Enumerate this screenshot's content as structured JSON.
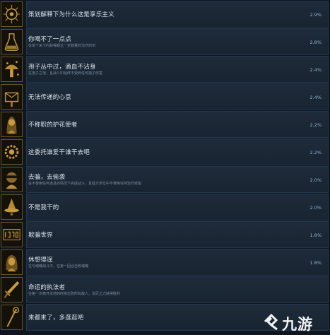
{
  "achievements": [
    {
      "title": "策划解释下为什么这是享乐主义",
      "description": "",
      "percent": "2.9%",
      "icon": "ornate-sun-icon"
    },
    {
      "title": "你喝不了一点点",
      "description": "在单个关卡内获得超过一定数量的治疗药剂",
      "percent": "2.8%",
      "icon": "flask-icon"
    },
    {
      "title": "孢子丛中过，滴血不沾身",
      "description": "在孢子之地，且战斗中始终不受到任何孢子伤害",
      "percent": "2.4%",
      "icon": "mushroom-spore-icon"
    },
    {
      "title": "无法传递的心意",
      "description": "",
      "percent": "2.4%",
      "icon": "mailbox-icon"
    },
    {
      "title": "不称职的护花使者",
      "description": "",
      "percent": "2.2%",
      "icon": "hooded-figure-icon"
    },
    {
      "title": "这委托谁爱干谁干去吧",
      "description": "",
      "percent": "2.2%",
      "icon": "gear-emblem-icon"
    },
    {
      "title": "去骗，去偷袭",
      "description": "在不使用任何道具的情况下完成战斗，且敌方单位中不使用任何治疗技能",
      "percent": "2.0%",
      "icon": "masked-thief-icon"
    },
    {
      "title": "不是我干的",
      "description": "",
      "percent": "2.0%",
      "icon": "witch-hat-icon"
    },
    {
      "title": "欺骗世界",
      "description": "",
      "percent": "1.8%",
      "icon": "digital-counter-icon"
    },
    {
      "title": "休想得逞",
      "description": "在与魂魄战斗中，在第一回合击败魂魄",
      "percent": "1.8%",
      "icon": "woman-portrait-icon"
    },
    {
      "title": "命运的执法者",
      "description": "在第一次离开本地的时候击败所有敌人，消灭之力获得胜利",
      "percent": "",
      "icon": "sword-icon"
    },
    {
      "title": "来都来了，多逛逛吧",
      "description": "",
      "percent": "",
      "icon": "staff-icon"
    }
  ],
  "watermark": {
    "text": "九游",
    "icon": "jiuyou-logo-icon"
  },
  "colors": {
    "gold": "#c99a3c",
    "background": "#0e1620",
    "row": "#1b2735",
    "percent": "#8fb3d5"
  }
}
